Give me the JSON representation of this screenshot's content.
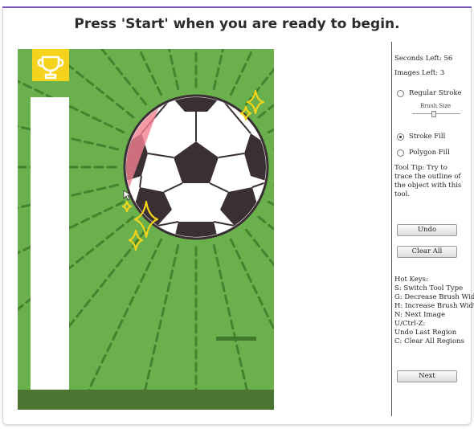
{
  "header": {
    "instruction": "Press 'Start' when you are ready to begin."
  },
  "colors": {
    "accent_bar": "#7e57c2",
    "canvas_bg": "#6ab04c",
    "ray": "#3f7a2c",
    "trophy_tile": "#f5d21b",
    "ball_dark": "#3a3034",
    "sparkle": "#f2d51a",
    "stroke_fill_region": "#f2808f",
    "ground": "#4b7530"
  },
  "icons": {
    "trophy": "trophy-icon",
    "cursor": "arrow-cursor-icon"
  },
  "panel": {
    "seconds_left": "Seconds Left: 56",
    "images_left": "Images Left: 3",
    "tools": [
      {
        "label": "Regular Stroke",
        "checked": false
      },
      {
        "label": "Stroke Fill",
        "checked": true
      },
      {
        "label": "Polygon Fill",
        "checked": false
      }
    ],
    "brush_size_label": "Brush Size",
    "brush_size_fraction": 0.45,
    "tooltip": "Tool Tip: Try to trace the outline of the object with this tool.",
    "undo_label": "Undo",
    "clear_all_label": "Clear All",
    "hotkeys": [
      "Hot Keys:",
      "S: Switch Tool Type",
      "G: Decrease Brush Width",
      "H: Increase Brush Width",
      "N: Next Image",
      "U/Ctrl-Z:",
      "Undo Last Region",
      "C: Clear All Regions"
    ],
    "next_label": "Next"
  }
}
